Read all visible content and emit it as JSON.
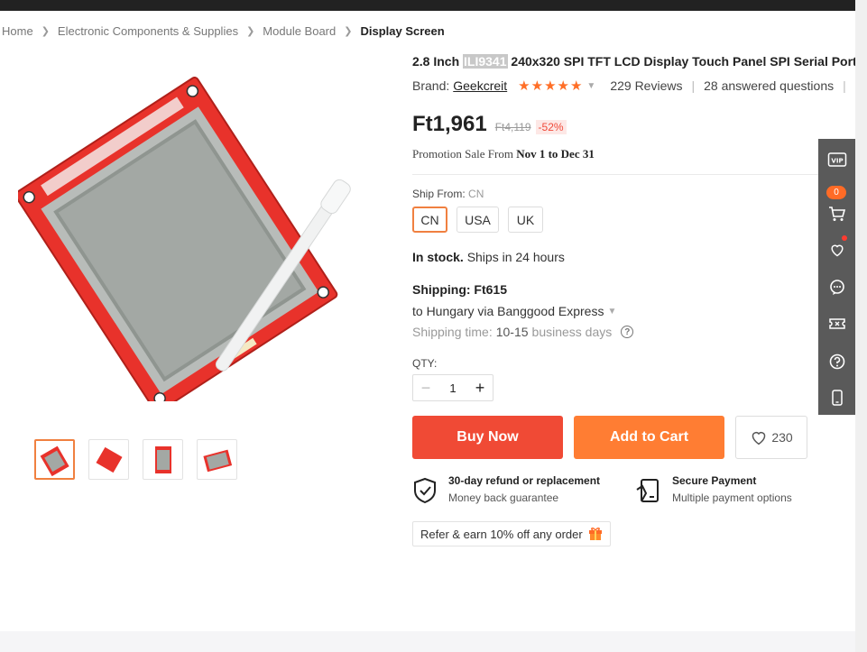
{
  "breadcrumb": {
    "items": [
      "Home",
      "Electronic Components & Supplies",
      "Module Board"
    ],
    "current": "Display Screen"
  },
  "product": {
    "title_before": "2.8 Inch ",
    "title_highlight": "ILI9341",
    "title_after": " 240x320 SPI TFT LCD Display Touch Panel SPI Serial Port",
    "brand_label": "Brand:",
    "brand_name": "Geekcreit",
    "rating_stars": "★★★★★",
    "reviews": "229 Reviews",
    "questions": "28 answered questions"
  },
  "pricing": {
    "price": "Ft1,961",
    "old_price": "Ft4,119",
    "discount": "-52%",
    "promo_prefix": "Promotion Sale From",
    "promo_range": "Nov 1 to Dec 31"
  },
  "shipping": {
    "ship_from_label": "Ship From:",
    "ship_from_value": "CN",
    "options": [
      "CN",
      "USA",
      "UK"
    ],
    "stock_bold": "In stock.",
    "stock_rest": "Ships in 24 hours",
    "shipping_cost": "Shipping: Ft615",
    "ship_to": "to Hungary via Banggood Express",
    "time_label": "Shipping time:",
    "time_days": "10-15",
    "time_unit": "business days"
  },
  "quantity": {
    "label": "QTY:",
    "value": "1"
  },
  "actions": {
    "buy_now": "Buy Now",
    "add_to_cart": "Add to Cart",
    "wishlist_count": "230"
  },
  "guarantees": {
    "refund_title": "30-day refund or replacement",
    "refund_sub": "Money back guarantee",
    "payment_title": "Secure Payment",
    "payment_sub": "Multiple payment options"
  },
  "refer": {
    "text": "Refer & earn 10% off any order"
  },
  "sidebar": {
    "cart_count": "0",
    "vip_label": "VIP"
  },
  "colors": {
    "buy_now": "#f04a35",
    "add_to_cart": "#ff7d33",
    "stars": "#ff6e26",
    "discount": "#f04a3a",
    "sidebar": "#5a5a5a"
  }
}
